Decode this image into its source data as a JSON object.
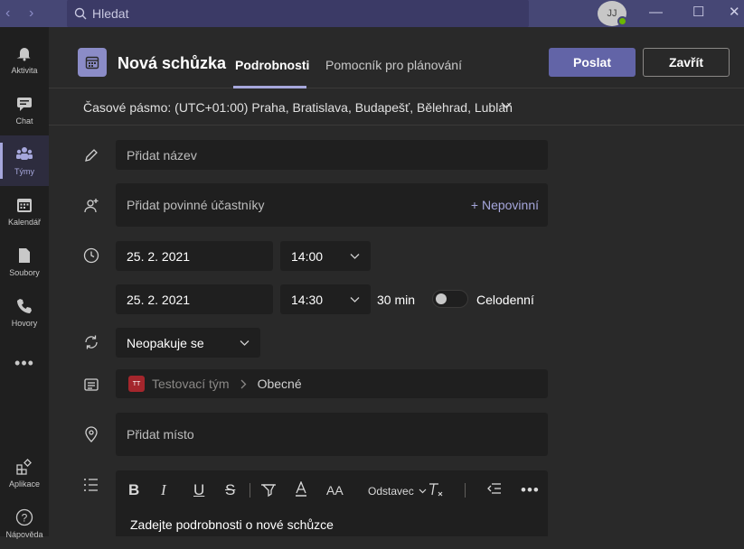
{
  "titlebar": {
    "search_placeholder": "Hledat",
    "avatar_initials": "JJ"
  },
  "rail": {
    "items": [
      {
        "label": "Aktivita",
        "icon": "bell-icon"
      },
      {
        "label": "Chat",
        "icon": "chat-icon"
      },
      {
        "label": "Týmy",
        "icon": "teams-icon",
        "active": true
      },
      {
        "label": "Kalendář",
        "icon": "calendar-icon"
      },
      {
        "label": "Soubory",
        "icon": "file-icon"
      },
      {
        "label": "Hovory",
        "icon": "phone-icon"
      },
      {
        "label": "",
        "icon": "more-icon"
      },
      {
        "label": "Aplikace",
        "icon": "apps-icon"
      },
      {
        "label": "Nápověda",
        "icon": "help-icon"
      }
    ]
  },
  "header": {
    "title": "Nová schůzka",
    "tabs": [
      {
        "label": "Podrobnosti",
        "active": true
      },
      {
        "label": "Pomocník pro plánování"
      }
    ],
    "send_label": "Poslat",
    "close_label": "Zavřít"
  },
  "timezone": {
    "label": "Časové pásmo: (UTC+01:00) Praha, Bratislava, Budapešť, Bělehrad, Lublaň"
  },
  "form": {
    "title_placeholder": "Přidat název",
    "attendees_placeholder": "Přidat povinné účastníky",
    "optional_link": "+ Nepovinní",
    "start_date": "25. 2. 2021",
    "start_time": "14:00",
    "end_date": "25. 2. 2021",
    "end_time": "14:30",
    "duration": "30 min",
    "all_day_label": "Celodenní",
    "all_day_on": false,
    "repeat": "Neopakuje se",
    "team_initials": "TT",
    "team_name": "Testovací tým",
    "channel_name": "Obecné",
    "location_placeholder": "Přidat místo",
    "paragraph_label": "Odstavec",
    "details_placeholder": "Zadejte podrobnosti o nové schůzce"
  },
  "colors": {
    "brand": "#6264a7",
    "titlebar": "#464775",
    "accent": "#a6a7dc",
    "presence": "#6bb700"
  }
}
